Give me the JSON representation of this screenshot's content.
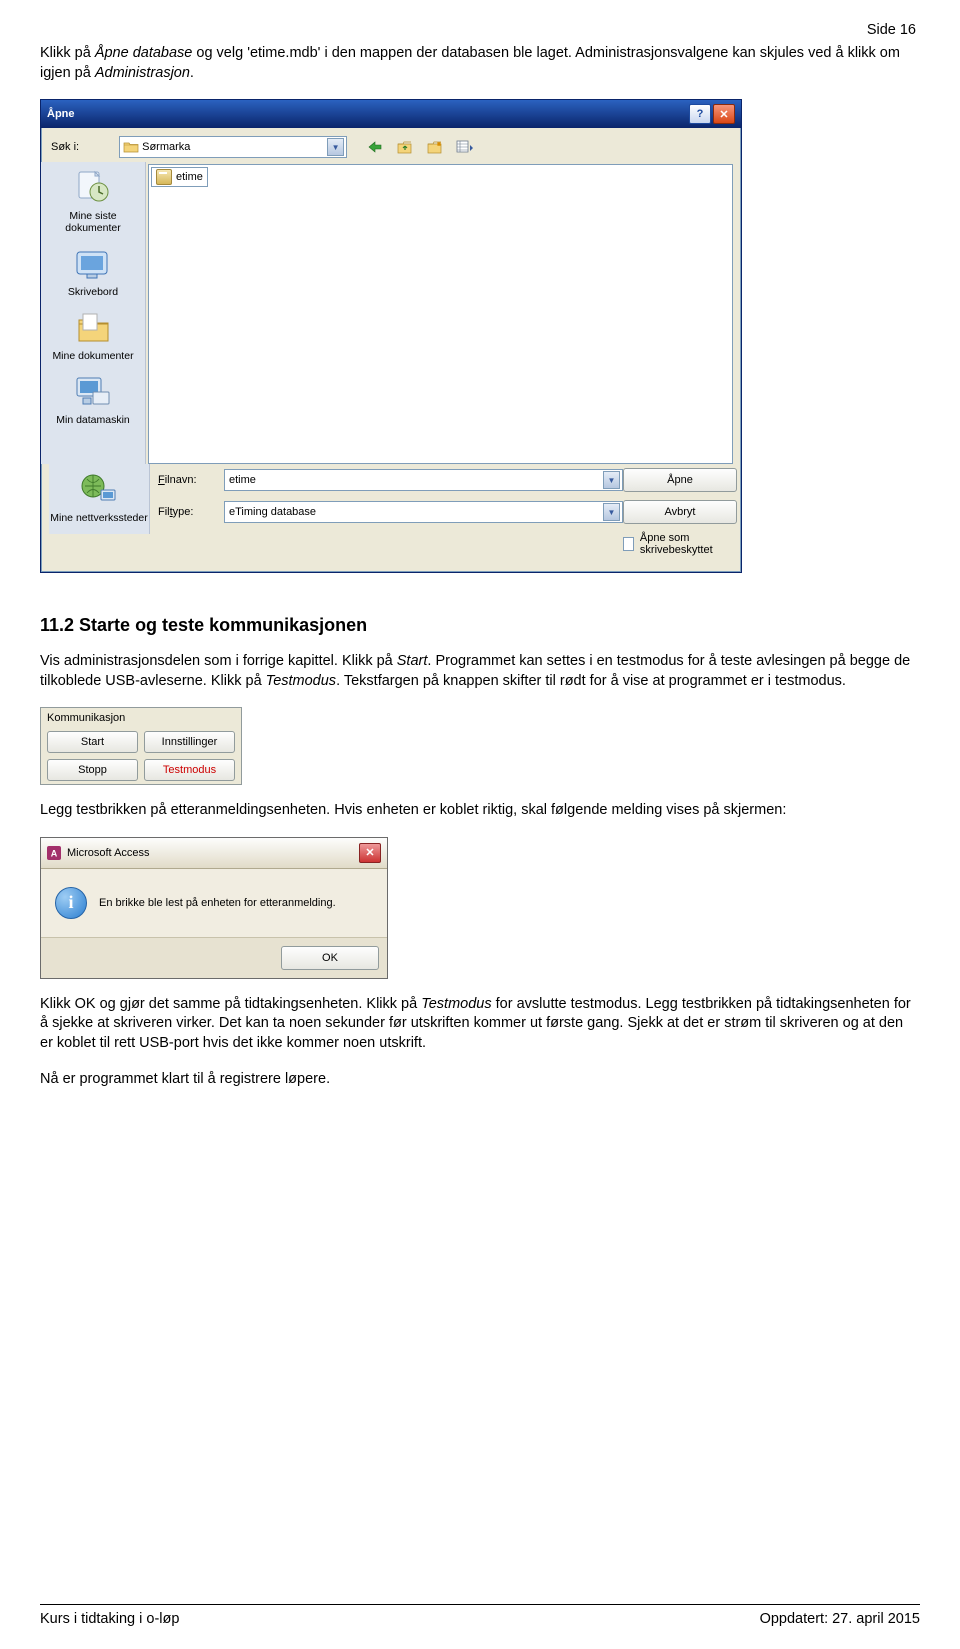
{
  "page_number": "Side 16",
  "intro_para": {
    "prefix": "Klikk på ",
    "italic1": "Åpne database",
    "mid1": " og velg 'etime.mdb' i den mappen der databasen ble laget. Administrasjonsvalgene kan skjules ved å klikk om igjen på ",
    "italic2": "Administrasjon",
    "suffix1": "."
  },
  "open_dialog": {
    "title": "Åpne",
    "search_label": "Søk i:",
    "folder_name": "Sørmarka",
    "file_shown": "etime",
    "places": [
      "Mine siste dokumenter",
      "Skrivebord",
      "Mine dokumenter",
      "Min datamaskin",
      "Mine nettverkssteder"
    ],
    "filename_label": "Filnavn:",
    "filetype_label": "Filtype:",
    "filename_value": "etime",
    "filetype_value": "eTiming database",
    "open_button": "Åpne",
    "cancel_button": "Avbryt",
    "readonly_label": "Åpne som skrivebeskyttet"
  },
  "heading": "11.2    Starte og teste kommunikasjonen",
  "para2": {
    "t1": "Vis administrasjonsdelen som i forrige kapittel. Klikk på ",
    "i1": "Start",
    "t2": ". Programmet kan settes i en testmodus for å teste avlesingen på begge de tilkoblede USB-avleserne. Klikk på ",
    "i2": "Testmodus",
    "t3": ". Tekstfargen på knappen skifter til rødt for å vise at programmet er i testmodus."
  },
  "komm": {
    "title": "Kommunikasjon",
    "start": "Start",
    "innst": "Innstillinger",
    "stopp": "Stopp",
    "test": "Testmodus"
  },
  "para3": "Legg testbrikken på etteranmeldingsenheten. Hvis enheten er koblet riktig, skal følgende melding vises på skjermen:",
  "msgbox": {
    "title": "Microsoft Access",
    "body": "En brikke ble lest på enheten for etteranmelding.",
    "ok": "OK"
  },
  "para4": {
    "t1": "Klikk OK og gjør det samme på tidtakingsenheten. Klikk på ",
    "i1": "Testmodus",
    "t2": " for avslutte testmodus. Legg testbrikken på tidtakingsenheten for å sjekke at skriveren virker. Det kan ta noen sekunder før utskriften kommer ut første gang. Sjekk at det er strøm til skriveren og at den er koblet til rett USB-port hvis det ikke kommer noen utskrift."
  },
  "para5": "Nå er programmet klart til å registrere løpere.",
  "footer": {
    "left": "Kurs i tidtaking i o-løp",
    "right": "Oppdatert: 27. april 2015"
  }
}
